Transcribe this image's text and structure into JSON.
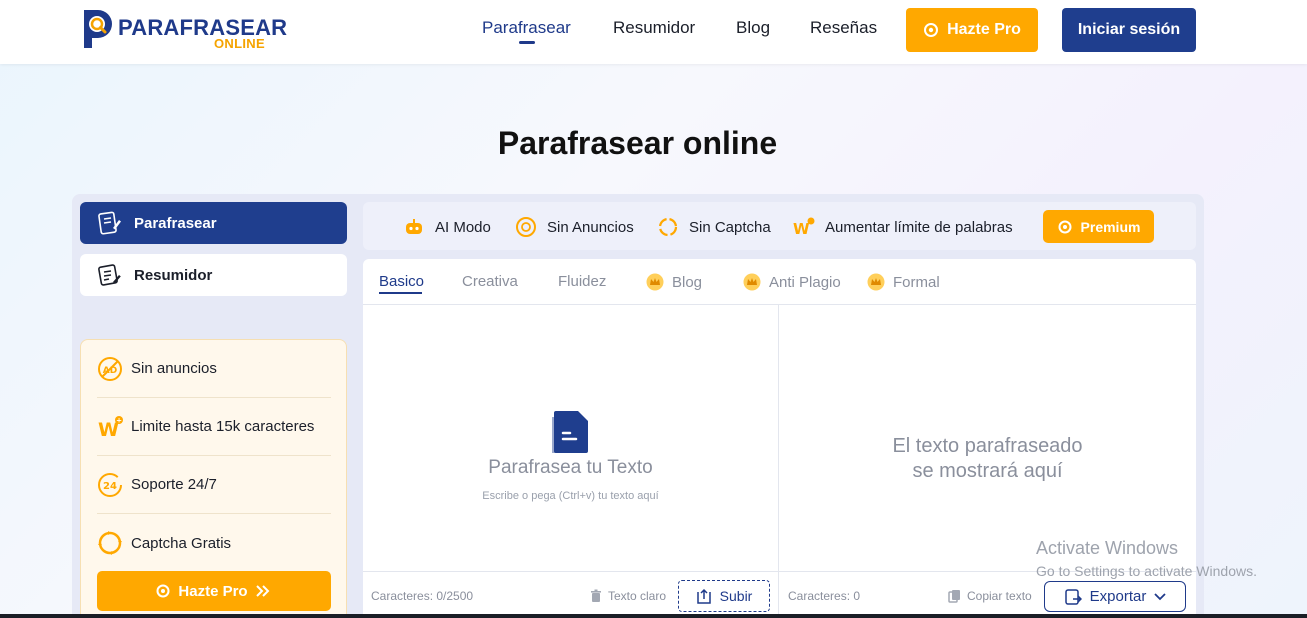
{
  "header": {
    "logo_main": "PARAFRASEAR",
    "logo_sub": "ONLINE",
    "nav": [
      {
        "label": "Parafrasear"
      },
      {
        "label": "Resumidor"
      },
      {
        "label": "Blog"
      },
      {
        "label": "Reseñas"
      }
    ],
    "pro_label": "Hazte Pro",
    "login_label": "Iniciar sesión"
  },
  "title": "Parafrasear online",
  "sidebar": {
    "tabs": [
      {
        "label": "Parafrasear"
      },
      {
        "label": "Resumidor"
      }
    ],
    "promo": [
      {
        "label": "Sin anuncios"
      },
      {
        "label": "Limite hasta 15k caracteres"
      },
      {
        "label": "Soporte 24/7"
      },
      {
        "label": "Captcha Gratis"
      }
    ],
    "promo_button": "Hazte Pro"
  },
  "features": [
    {
      "label": "AI Modo"
    },
    {
      "label": "Sin Anuncios"
    },
    {
      "label": "Sin Captcha"
    },
    {
      "label": "Aumentar límite de palabras"
    }
  ],
  "premium_label": "Premium",
  "modes": [
    {
      "label": "Basico"
    },
    {
      "label": "Creativa"
    },
    {
      "label": "Fluidez"
    },
    {
      "label": "Blog"
    },
    {
      "label": "Anti Plagio"
    },
    {
      "label": "Formal"
    }
  ],
  "input": {
    "title": "Parafrasea tu Texto",
    "subtitle": "Escribe o pega (Ctrl+v) tu texto aquí",
    "char_count": "Caracteres: 0/2500",
    "clear_label": "Texto claro",
    "upload_label": "Subir"
  },
  "output": {
    "placeholder_line1": "El texto parafraseado",
    "placeholder_line2": "se mostrará aquí",
    "char_count": "Caracteres: 0",
    "copy_label": "Copiar texto",
    "export_label": "Exportar"
  },
  "watermark": {
    "line1": "Activate Windows",
    "line2": "Go to Settings to activate Windows."
  },
  "colors": {
    "primary": "#1f3e8e",
    "accent": "#ffa800"
  }
}
